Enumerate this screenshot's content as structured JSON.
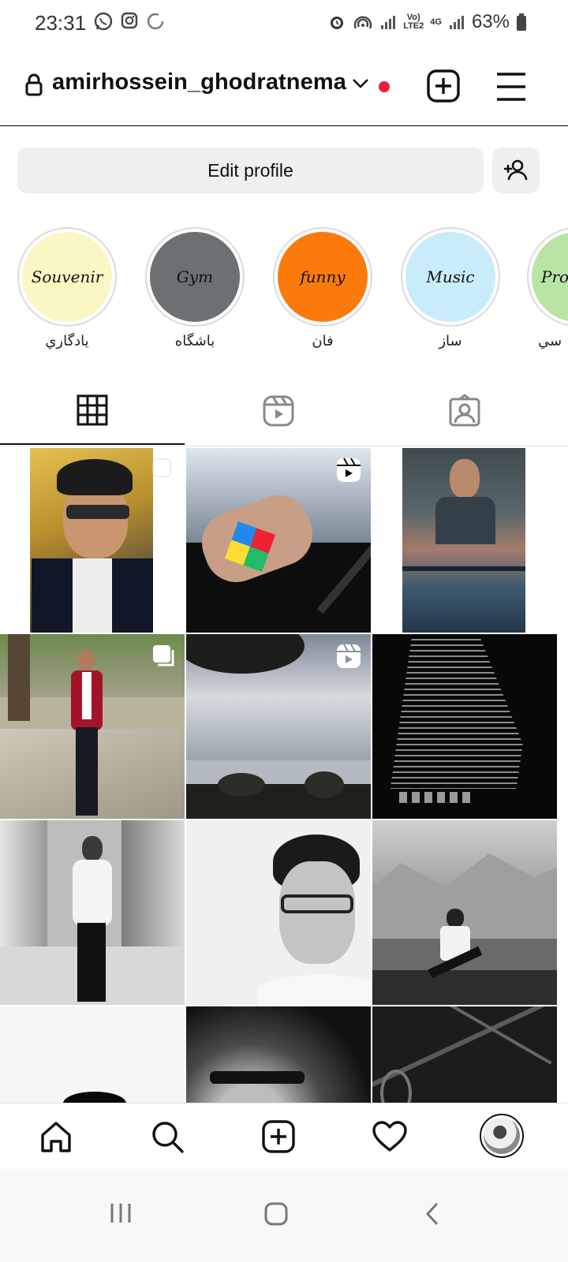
{
  "status_bar": {
    "time": "23:31",
    "battery": "63%",
    "lte_line1": "Vo)",
    "lte_line2": "LTE2",
    "net": "4G",
    "icons": [
      "whatsapp-icon",
      "instagram-icon",
      "sync-icon",
      "alarm-icon",
      "hotspot-icon",
      "signal-icon",
      "signal-icon",
      "battery-icon"
    ]
  },
  "header": {
    "username": "amirhossein_ghodratnema",
    "notification_color": "#ee1d3f"
  },
  "profile_actions": {
    "edit_label": "Edit profile"
  },
  "highlights": [
    {
      "title": "Souvenir",
      "label": "يادگاري",
      "color": "#fbf7c4"
    },
    {
      "title": "Gym",
      "label": "باشگاه",
      "color": "#6d7072"
    },
    {
      "title": "funny",
      "label": "فان",
      "color": "#fb7a0c"
    },
    {
      "title": "Music",
      "label": "ساز",
      "color": "#c9ecfb"
    },
    {
      "title": "Pro",
      "label": "سي",
      "color": "#b9e5a4"
    }
  ],
  "tabs": [
    {
      "name": "grid",
      "active": true
    },
    {
      "name": "reels",
      "active": false
    },
    {
      "name": "tagged",
      "active": false
    }
  ],
  "grid_posts": [
    {
      "type": "carousel",
      "bg": "#d3a93a"
    },
    {
      "type": "reel",
      "bg": "#0d0d0d"
    },
    {
      "type": "photo",
      "bg": "#4d5a60"
    },
    {
      "type": "carousel",
      "bg": "#a8a18c"
    },
    {
      "type": "reel",
      "bg": "#b4bac2"
    },
    {
      "type": "photo",
      "bg": "#080808"
    },
    {
      "type": "photo",
      "bg": "#bdbdbd"
    },
    {
      "type": "photo",
      "bg": "#f0f0f0"
    },
    {
      "type": "photo",
      "bg": "#6a6a6a"
    },
    {
      "type": "photo",
      "bg": "#f6f6f6"
    },
    {
      "type": "photo",
      "bg": "#2a2a2a"
    },
    {
      "type": "photo",
      "bg": "#1c1c1c"
    }
  ],
  "bottom_nav": [
    "home-icon",
    "search-icon",
    "create-icon",
    "activity-heart-icon",
    "profile-avatar"
  ]
}
